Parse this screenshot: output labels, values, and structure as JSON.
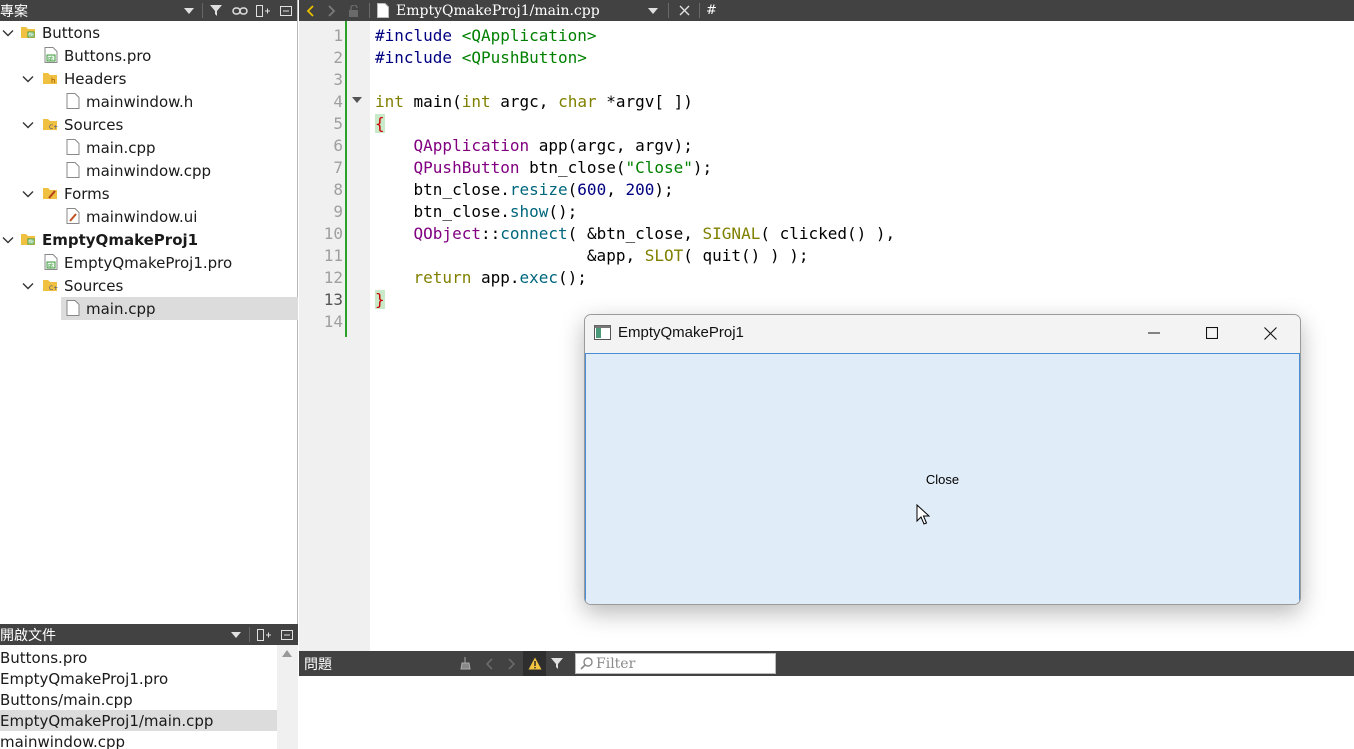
{
  "project_panel": {
    "title": "專案",
    "tree": [
      {
        "label": "Buttons",
        "bold": false
      },
      {
        "label": "Buttons.pro"
      },
      {
        "label": "Headers"
      },
      {
        "label": "mainwindow.h"
      },
      {
        "label": "Sources"
      },
      {
        "label": "main.cpp"
      },
      {
        "label": "mainwindow.cpp"
      },
      {
        "label": "Forms"
      },
      {
        "label": "mainwindow.ui"
      },
      {
        "label": "EmptyQmakeProj1",
        "bold": true
      },
      {
        "label": "EmptyQmakeProj1.pro"
      },
      {
        "label": "Sources"
      },
      {
        "label": "main.cpp",
        "selected": true
      }
    ]
  },
  "open_documents": {
    "title": "開啟文件",
    "items": [
      {
        "label": "Buttons.pro"
      },
      {
        "label": "EmptyQmakeProj1.pro"
      },
      {
        "label": "Buttons/main.cpp"
      },
      {
        "label": "EmptyQmakeProj1/main.cpp",
        "selected": true
      },
      {
        "label": "mainwindow.cpp"
      }
    ]
  },
  "editor": {
    "current_file": "EmptyQmakeProj1/main.cpp",
    "symbol_hint": "#",
    "current_line": 13,
    "line_numbers": [
      "1",
      "2",
      "3",
      "4",
      "5",
      "6",
      "7",
      "8",
      "9",
      "10",
      "11",
      "12",
      "13",
      "14"
    ]
  },
  "issues_panel": {
    "title": "問題",
    "filter_placeholder": "Filter"
  },
  "app_window": {
    "title": "EmptyQmakeProj1",
    "button_label": "Close"
  },
  "colors": {
    "panel_bar": "#424242",
    "change_marker": "#2aa12a",
    "window_client": "#e0ecf8",
    "window_border": "#4a8fd6"
  }
}
